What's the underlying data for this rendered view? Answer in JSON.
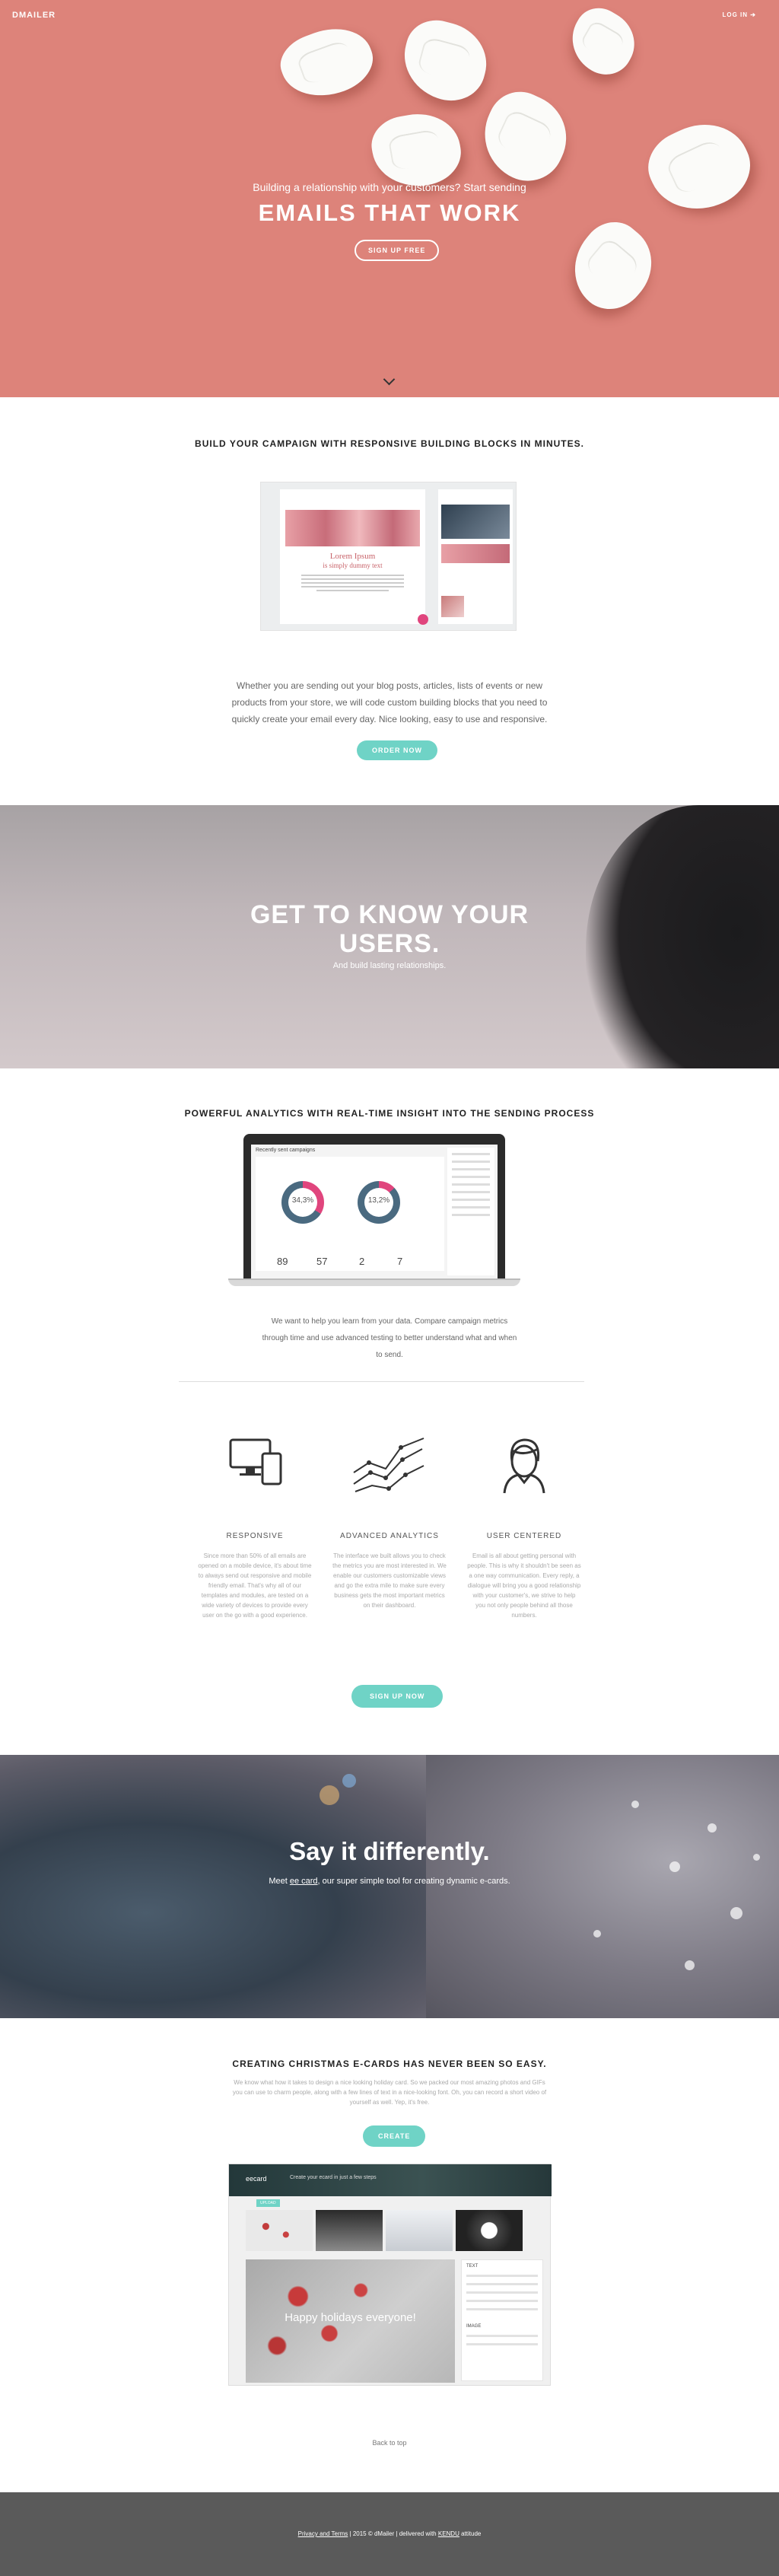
{
  "header": {
    "logo": "DMAILER",
    "login": "LOG IN"
  },
  "hero": {
    "subtitle": "Building a relationship with your customers? Start sending",
    "title": "EMAILS THAT WORK",
    "cta": "SIGN UP FREE",
    "scroll": "chevron-down"
  },
  "builder_section": {
    "title": "BUILD YOUR CAMPAIGN WITH RESPONSIVE BUILDING BLOCKS IN MINUTES.",
    "preview_heading_1": "Lorem Ipsum",
    "preview_heading_2": "is simply dummy text",
    "text": "Whether you are sending out your blog posts, articles, lists of events or new products from your store, we will code custom building blocks that you need to quickly create your email every day. Nice looking, easy to use and responsive.",
    "cta": "ORDER NOW"
  },
  "users_section": {
    "title": "GET TO KNOW YOUR USERS.",
    "subtitle": "And build lasting relationships."
  },
  "analytics_section": {
    "title": "POWERFUL ANALYTICS WITH REAL-TIME INSIGHT INTO THE SENDING PROCESS",
    "dashboard_title": "Recently sent campaigns",
    "donuts": [
      "34,3%",
      "13,2%"
    ],
    "stats": [
      "89",
      "57",
      "2",
      "7"
    ],
    "text": "We want to help you learn from your data. Compare campaign metrics through time and use advanced testing to better understand what and when to send."
  },
  "features": [
    {
      "icon": "devices-icon",
      "title": "RESPONSIVE",
      "text": "Since more than 50% of all emails are opened on a mobile device, it's about time to always send out responsive and mobile friendly email. That's why all of our templates and modules, are tested on a wide variety of devices to provide every user on the go with a good experience."
    },
    {
      "icon": "analytics-graph-icon",
      "title": "ADVANCED ANALYTICS",
      "text": "The interface we built allows you to check the metrics you are most interested in. We enable our customers customizable views and go the extra mile to make sure every business gets the most important metrics on their dashboard."
    },
    {
      "icon": "user-icon",
      "title": "USER CENTERED",
      "text": "Email is all about getting personal with people. This is why it shouldn't be seen as a one way communication. Every reply, a dialogue will bring you a good relationship with your customer's, we strive to help you not only people behind all those numbers."
    }
  ],
  "features_cta": "SIGN UP NOW",
  "say_section": {
    "title": "Say it differently.",
    "subtitle_pre": "Meet ",
    "subtitle_link": "ee card",
    "subtitle_post": ", our super simple tool for creating dynamic e-cards."
  },
  "christmas_section": {
    "title": "CREATING CHRISTMAS E-CARDS HAS NEVER BEEN SO EASY.",
    "text": "We know what how it takes to design a nice looking holiday card. So we packed our most amazing photos and GIFs you can use to charm people, along with a few lines of text in a nice-looking font. Oh, you can record a short video of yourself as well. Yep, it's free.",
    "cta": "CREATE",
    "editor_logo": "eecard",
    "editor_step": "Create your ecard in just a few steps",
    "editor_badge": "UPLOAD",
    "canvas_text": "Happy holidays everyone!",
    "panel_text": "TEXT",
    "panel_image": "IMAGE"
  },
  "back_to_top": "Back to top",
  "footer": {
    "links": "Privacy and Terms",
    "text": " | 2015 © dMailer | delivered with ",
    "brand": "KENDU",
    "tail": " attitude"
  }
}
